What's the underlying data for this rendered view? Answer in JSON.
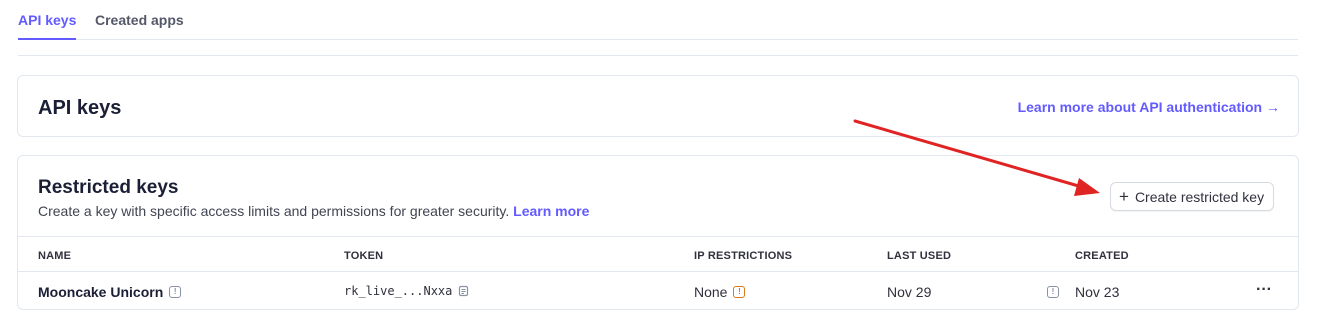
{
  "tabs": [
    {
      "label": "API keys",
      "active": true
    },
    {
      "label": "Created apps",
      "active": false
    }
  ],
  "api_keys_card": {
    "title": "API keys",
    "learn_link": "Learn more about API authentication →"
  },
  "restricted_keys": {
    "title": "Restricted keys",
    "description": "Create a key with specific access limits and permissions for greater security.",
    "learn_more": "Learn more",
    "create_button": "Create restricted key",
    "columns": [
      "NAME",
      "TOKEN",
      "IP RESTRICTIONS",
      "LAST USED",
      "CREATED"
    ],
    "rows": [
      {
        "name": "Mooncake Unicorn",
        "token": "rk_live_...Nxxa",
        "ip_restrictions": "None",
        "last_used": "Nov 29",
        "created": "Nov 23",
        "more": "···"
      }
    ]
  },
  "colors": {
    "accent": "#635bff",
    "warning": "#d97917",
    "annotation_arrow": "#e02424"
  },
  "icons": {
    "plus": "plus-icon",
    "info": "info-icon",
    "warning": "warning-icon",
    "copy": "copy-icon",
    "more": "more-options-icon"
  }
}
